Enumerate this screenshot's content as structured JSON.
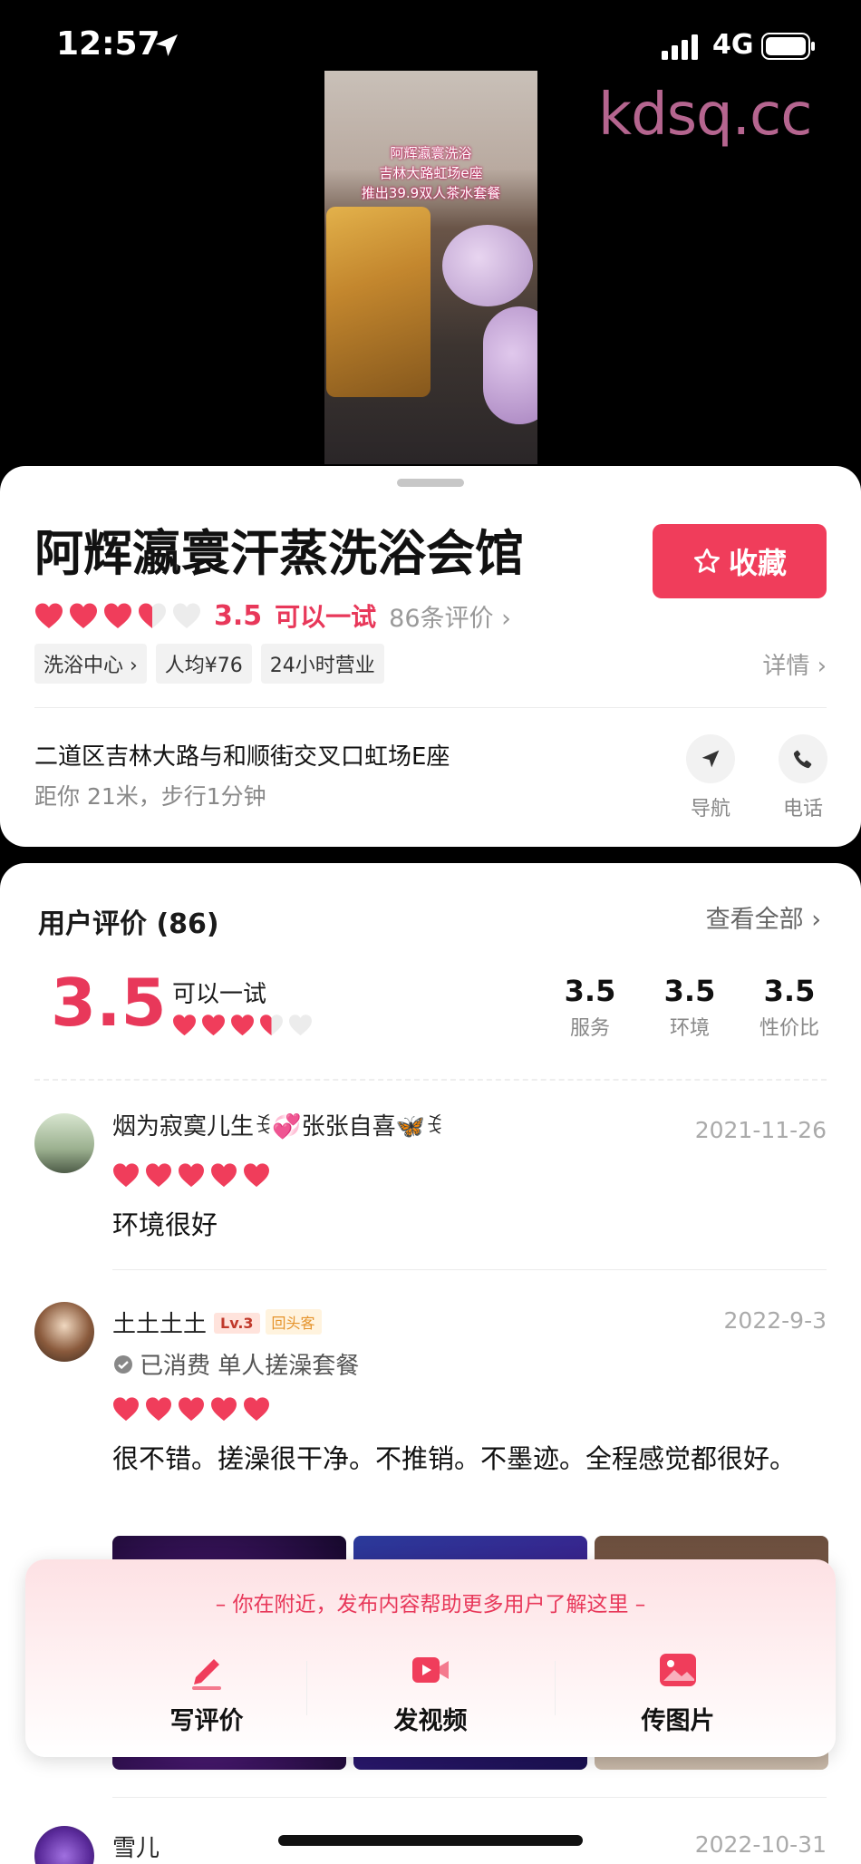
{
  "status_bar": {
    "time": "12:57",
    "network": "4G"
  },
  "video": {
    "caption_lines": [
      "阿辉瀛寰洗浴",
      "吉林大路虹场e座",
      "推出39.9双人茶水套餐"
    ],
    "watermark": "kdsq.cc"
  },
  "shop": {
    "title": "阿辉瀛寰汗蒸洗浴会馆",
    "favorite_label": "收藏",
    "rating": "3.5",
    "rating_value": 3.5,
    "verdict": "可以一试",
    "review_count": "86条评价 ›",
    "tags": [
      "洗浴中心 ›",
      "人均¥76",
      "24小时营业"
    ],
    "details_label": "详情 ›",
    "address": "二道区吉林大路与和顺街交叉口虹场E座",
    "distance": "距你 21米，步行1分钟",
    "nav_label": "导航",
    "phone_label": "电话"
  },
  "reviews": {
    "heading": "用户评价 (86)",
    "see_all": "查看全部 ›",
    "score": "3.5",
    "verdict": "可以一试",
    "sub_scores": [
      {
        "value": "3.5",
        "label": "服务"
      },
      {
        "value": "3.5",
        "label": "环境"
      },
      {
        "value": "3.5",
        "label": "性价比"
      }
    ],
    "items": [
      {
        "name": "烟为寂寞儿生ꉂ💞张张自喜🦋ꉂ",
        "date": "2021-11-26",
        "rating": 5,
        "text": "环境很好"
      },
      {
        "name": "土土土土",
        "level": "Lv.3",
        "badge": "回头客",
        "consumed": "已消费 单人搓澡套餐",
        "date": "2022-9-3",
        "rating": 5,
        "text": "很不错。搓澡很干净。不推销。不墨迹。全程感觉都很好。"
      },
      {
        "name": "雪儿",
        "date": "2022-10-31"
      }
    ]
  },
  "post_sheet": {
    "prompt": "– 你在附近，发布内容帮助更多用户了解这里 –",
    "buttons": [
      "写评价",
      "发视频",
      "传图片"
    ]
  },
  "colors": {
    "accent": "#f03d5b",
    "heart": "#e8385a"
  }
}
